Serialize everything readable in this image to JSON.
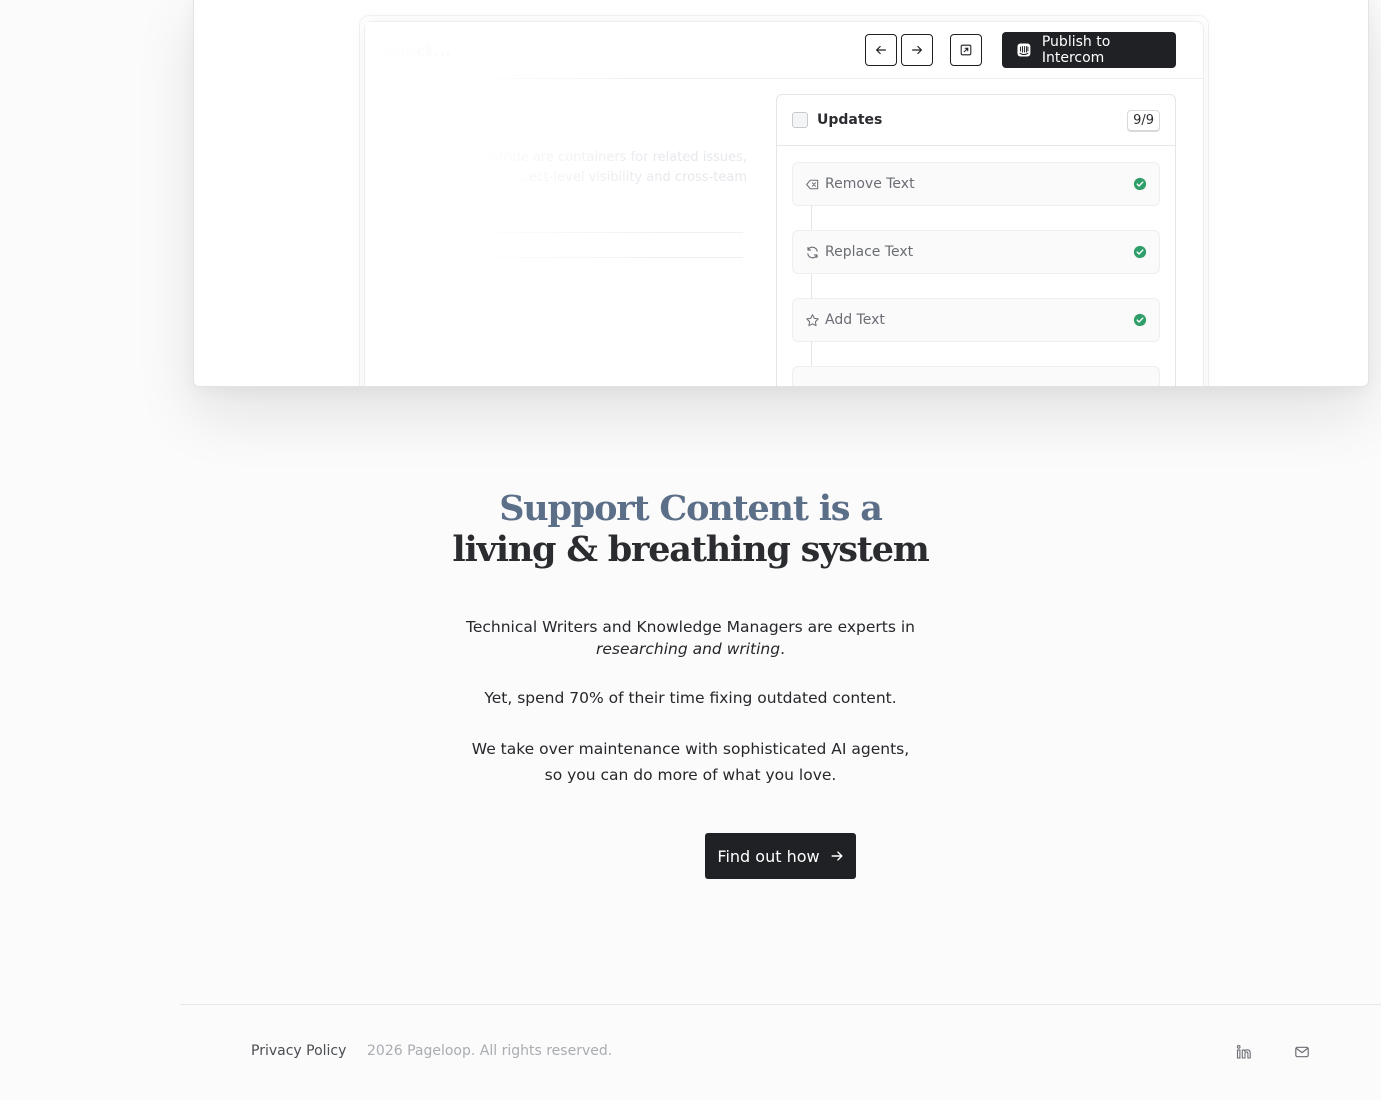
{
  "demo": {
    "project_title": "Project...",
    "publish_label": "Publish to Intercom",
    "ghost_text": "...s in Stride are containers for related issues, ...ect-level visibility and cross-team",
    "updates": {
      "title": "Updates",
      "count": "9/9",
      "items": [
        {
          "label": "Remove Text",
          "icon": "remove-text-icon",
          "status": "done"
        },
        {
          "label": "Replace Text",
          "icon": "refresh-icon",
          "status": "done"
        },
        {
          "label": "Add Text",
          "icon": "star-icon",
          "status": "done"
        }
      ]
    }
  },
  "hero": {
    "headline_line1": "Support Content is a",
    "headline_line2": "living & breathing system",
    "para1_main": "Technical Writers and Knowledge Managers are experts in",
    "para1_emph": "researching and writing",
    "para1_end": ".",
    "para2": "Yet, spend 70% of their time fixing outdated content.",
    "para3_line1": "We take over maintenance with sophisticated AI agents,",
    "para3_line2": "so you can do more of what you love.",
    "cta_label": "Find out how"
  },
  "footer": {
    "privacy_label": "Privacy Policy",
    "copyright": "2026 Pageloop. All rights reserved."
  },
  "colors": {
    "accent_dark": "#1f2125",
    "headline_blue": "#5c6f88",
    "success_green": "#2f9e6a"
  }
}
